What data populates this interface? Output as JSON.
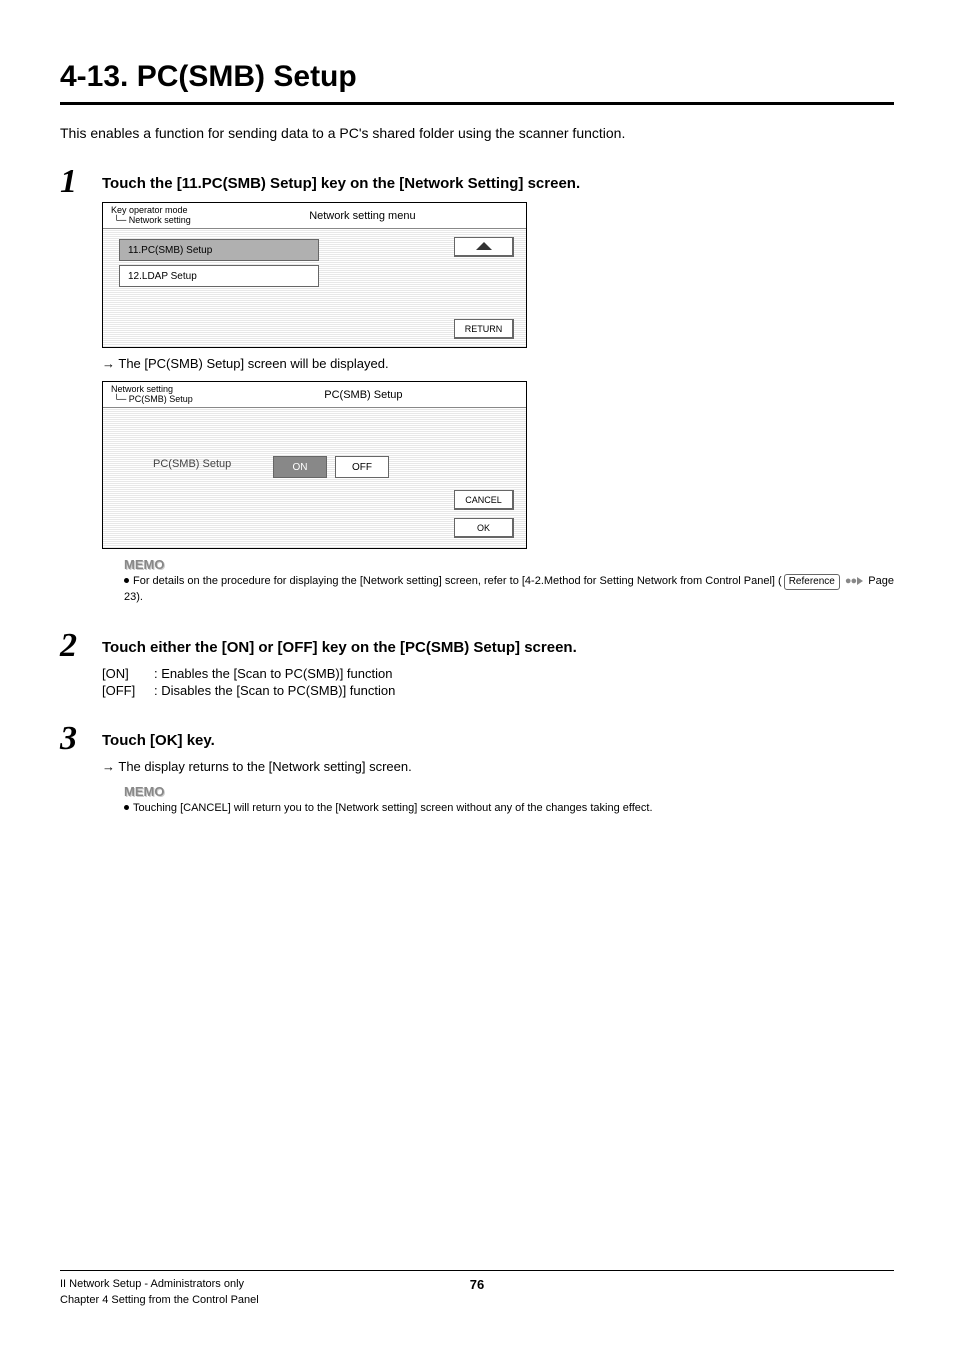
{
  "title": "4-13. PC(SMB) Setup",
  "intro": "This enables a function for sending data to a PC's shared folder using the scanner function.",
  "steps": {
    "s1": {
      "num": "1",
      "title": "Touch the [11.PC(SMB) Setup] key on the [Network Setting] screen.",
      "screenA": {
        "crumb": "Key operator mode\n └─ Network setting",
        "heading": "Network setting menu",
        "item1": "11.PC(SMB) Setup",
        "item2": "12.LDAP Setup",
        "return": "RETURN"
      },
      "arrow": "→ The [PC(SMB) Setup] screen will be displayed.",
      "screenB": {
        "crumb": "Network setting\n └─ PC(SMB) Setup",
        "heading": "PC(SMB) Setup",
        "label": "PC(SMB) Setup",
        "on": "ON",
        "off": "OFF",
        "cancel": "CANCEL",
        "ok": "OK"
      },
      "memoLabel": "MEMO",
      "memoText1": "For details on the procedure for displaying the [Network setting] screen, refer to [4-2.Method for Setting Network from Control Panel] (",
      "ref": "Reference",
      "memoText2": " Page 23)."
    },
    "s2": {
      "num": "2",
      "title": "Touch either the [ON] or [OFF] key on the [PC(SMB) Setup] screen.",
      "rows": {
        "on": {
          "key": "[ON]",
          "val": ": Enables the [Scan to PC(SMB)] function"
        },
        "off": {
          "key": "[OFF]",
          "val": ": Disables the [Scan to PC(SMB)] function"
        }
      }
    },
    "s3": {
      "num": "3",
      "title": "Touch [OK] key.",
      "arrow": "→ The display returns to the [Network setting] screen.",
      "memoLabel": "MEMO",
      "memoText": "Touching [CANCEL] will return you to the [Network setting] screen without any of the changes taking effect."
    }
  },
  "footer": {
    "line1": "II Network Setup - Administrators only",
    "line2": "Chapter 4 Setting from the Control Panel",
    "page": "76"
  }
}
